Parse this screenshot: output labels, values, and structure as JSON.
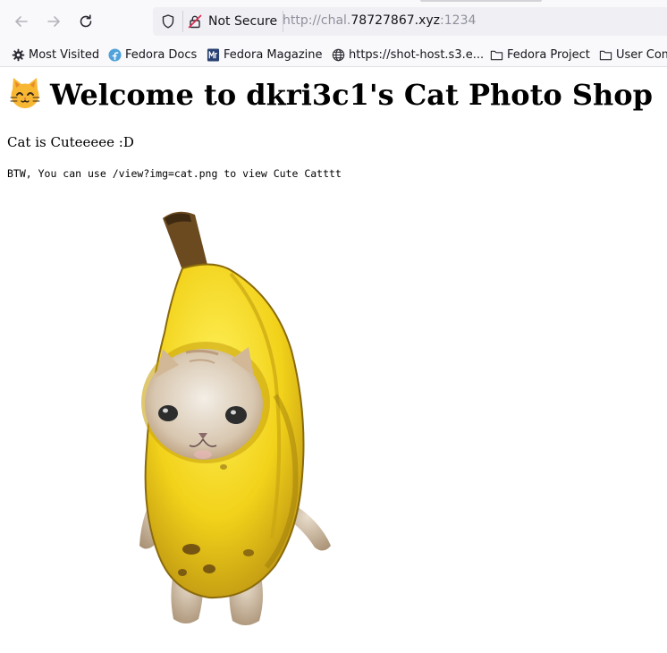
{
  "browser": {
    "back_icon": "arrow-left-icon",
    "forward_icon": "arrow-right-icon",
    "reload_icon": "reload-icon",
    "url_bar": {
      "security_label": "Not Secure",
      "url_prefix": "http://chal.",
      "url_host": "78727867.xyz",
      "url_suffix": ":1234"
    },
    "bookmarks": [
      {
        "label": "Most Visited",
        "icon": "gear-icon"
      },
      {
        "label": "Fedora Docs",
        "icon": "fedora-icon"
      },
      {
        "label": "Fedora Magazine",
        "icon": "fedora-magazine-icon"
      },
      {
        "label": "https://shot-host.s3.e...",
        "icon": "globe-icon"
      },
      {
        "label": "Fedora Project",
        "icon": "folder-icon"
      },
      {
        "label": "User Com",
        "icon": "folder-icon"
      }
    ]
  },
  "page": {
    "title_emoji": "cat-face-icon",
    "title": "Welcome to dkri3c1's Cat Photo Shop",
    "subtitle": "Cat is Cuteeeee :D",
    "hint": "BTW, You can use /view?img=cat.png to view Cute Catttt",
    "image": "banana-cat-image"
  },
  "colors": {
    "chrome_bg": "#f9f9fb",
    "url_bar_bg": "#f0f0f4",
    "banana_yellow": "#f2d21a",
    "url_grey": "#8f8f9d"
  }
}
